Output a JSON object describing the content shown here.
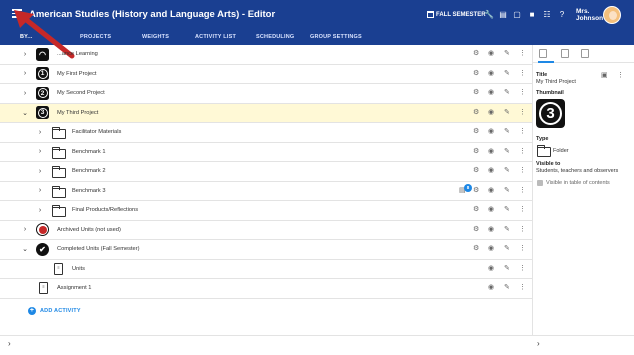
{
  "header": {
    "title": "American Studies (History and Language Arts) - Editor",
    "semester": "FALL SEMESTER",
    "user_line1": "Mrs.",
    "user_line2": "Johnson",
    "bg_color": "#1a3f91"
  },
  "tabs": [
    {
      "label": "BY..."
    },
    {
      "label": "PROJECTS"
    },
    {
      "label": "WEIGHTS"
    },
    {
      "label": "ACTIVITY LIST"
    },
    {
      "label": "SCHEDULING"
    },
    {
      "label": "GROUP SETTINGS"
    }
  ],
  "rows": [
    {
      "label": "...ance Learning",
      "icon": "wifi-icon"
    },
    {
      "label": "My First Project",
      "icon": "number-1-icon",
      "num": "1"
    },
    {
      "label": "My Second Project",
      "icon": "number-2-icon",
      "num": "2"
    },
    {
      "label": "My Third Project",
      "icon": "number-3-icon",
      "num": "3",
      "selected": true
    },
    {
      "label": "Facilitator Materials",
      "icon": "folder-icon"
    },
    {
      "label": "Benchmark 1",
      "icon": "folder-icon"
    },
    {
      "label": "Benchmark 2",
      "icon": "folder-icon"
    },
    {
      "label": "Benchmark 3",
      "icon": "folder-icon",
      "badge": "8"
    },
    {
      "label": "Final Products/Reflections",
      "icon": "folder-icon"
    },
    {
      "label": "Archived Units (not used)",
      "icon": "archive-icon"
    },
    {
      "label": "Completed Units (Fall Semester)",
      "icon": "check-icon"
    },
    {
      "label": "Units",
      "icon": "document-icon"
    },
    {
      "label": "Assignment 1",
      "icon": "document-icon"
    }
  ],
  "add_activity": "ADD ACTIVITY",
  "details": {
    "title_label": "Title",
    "title_value": "My Third Project",
    "thumbnail_label": "Thumbnail",
    "thumbnail_num": "3",
    "type_label": "Type",
    "type_value": "Folder",
    "visible_label": "Visible to",
    "visible_value": "Students, teachers and observers",
    "toc_label": "Visible in table of contents"
  },
  "accent_color": "#1e88e5",
  "selected_color": "#fff9d6"
}
